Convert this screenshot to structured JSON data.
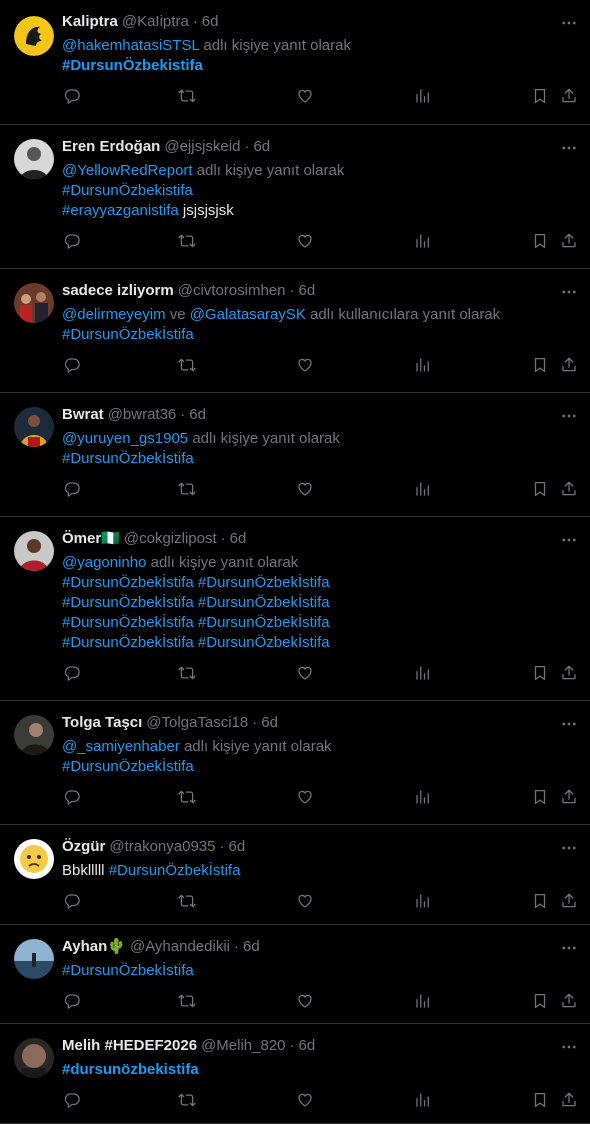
{
  "tweets": [
    {
      "name": "Kaliptra",
      "handle": "@KaIiptra",
      "time": "6d",
      "reply": {
        "mentions": "@hakemhatasiSTSL",
        "suffix": " adlı kişiye yanıt olarak"
      },
      "lines": [
        [
          "#DursunÖzbekistifa"
        ]
      ],
      "bold_tags": true,
      "avatar": "yellow-logo"
    },
    {
      "name": "Eren Erdoğan",
      "handle": "@ejjsjskeid",
      "time": "6d",
      "reply": {
        "mentions": "@YellowRedReport",
        "suffix": " adlı kişiye yanıt olarak"
      },
      "lines": [
        [
          "#DursunÖzbekistifa"
        ],
        [
          "#erayyazganistifa",
          " jsjsjsjsk"
        ]
      ],
      "bold_tags": false,
      "avatar": "portrait"
    },
    {
      "name": "sadece izliyorm",
      "handle": "@civtorosimhen",
      "time": "6d",
      "reply": {
        "mentions": "@delirmeyeyim ve @GalatasaraySK",
        "suffix": " adlı kullanıcılara yanıt olarak"
      },
      "lines": [
        [
          "#DursunÖzbekİstifa"
        ]
      ],
      "bold_tags": false,
      "avatar": "crowd"
    },
    {
      "name": "Bwrat",
      "handle": "@bwrat36",
      "time": "6d",
      "reply": {
        "mentions": "@yuruyen_gs1905",
        "suffix": " adlı kişiye yanıt olarak"
      },
      "lines": [
        [
          "#DursunÖzbekİstifa"
        ]
      ],
      "bold_tags": false,
      "avatar": "player"
    },
    {
      "name": "Ömer🇳🇬",
      "handle": "@cokgizlipost",
      "time": "6d",
      "reply": {
        "mentions": "@yagoninho",
        "suffix": " adlı kişiye yanıt olarak"
      },
      "lines": [
        [
          "#DursunÖzbekİstifa #DursunÖzbekİstifa"
        ],
        [
          "#DursunÖzbekİstifa #DursunÖzbekİstifa"
        ],
        [
          "#DursunÖzbekİstifa #DursunÖzbekİstifa"
        ],
        [
          "#DursunÖzbekİstifa #DursunÖzbekİstifa"
        ]
      ],
      "bold_tags": false,
      "avatar": "player2"
    },
    {
      "name": "Tolga Taşcı",
      "handle": "@TolgaTasci18",
      "time": "6d",
      "reply": {
        "mentions": "@_samiyenhaber",
        "suffix": " adlı kişiye yanıt olarak"
      },
      "lines": [
        [
          "#DursunÖzbekİstifa"
        ]
      ],
      "bold_tags": false,
      "avatar": "man"
    },
    {
      "name": "Özgür",
      "handle": "@trakonya0935",
      "time": "6d",
      "reply": null,
      "lines": [
        [
          "Bbklllll ",
          "#DursunÖzbekİstifa"
        ]
      ],
      "bold_tags": false,
      "avatar": "emoji"
    },
    {
      "name": "Ayhan🌵",
      "handle": "@Ayhandedikii",
      "time": "6d",
      "reply": null,
      "lines": [
        [
          "#DursunÖzbekİstifa"
        ]
      ],
      "bold_tags": false,
      "avatar": "sea"
    },
    {
      "name": "Melih #HEDEF2026",
      "handle": "@Melih_820",
      "time": "6d",
      "reply": null,
      "lines": [
        [
          "#dursunözbekistifa"
        ]
      ],
      "bold_tags": true,
      "avatar": "face"
    }
  ],
  "labels": {
    "reply_suffix": " adlı kişiye yanıt olarak"
  },
  "colors": {
    "link": "#1d9bf0",
    "muted": "#71767b",
    "text": "#e7e9ea",
    "border": "#2f3336",
    "background": "#000000"
  },
  "icons": [
    "reply-icon",
    "retweet-icon",
    "like-icon",
    "views-icon",
    "bookmark-icon",
    "share-icon",
    "more-icon"
  ]
}
